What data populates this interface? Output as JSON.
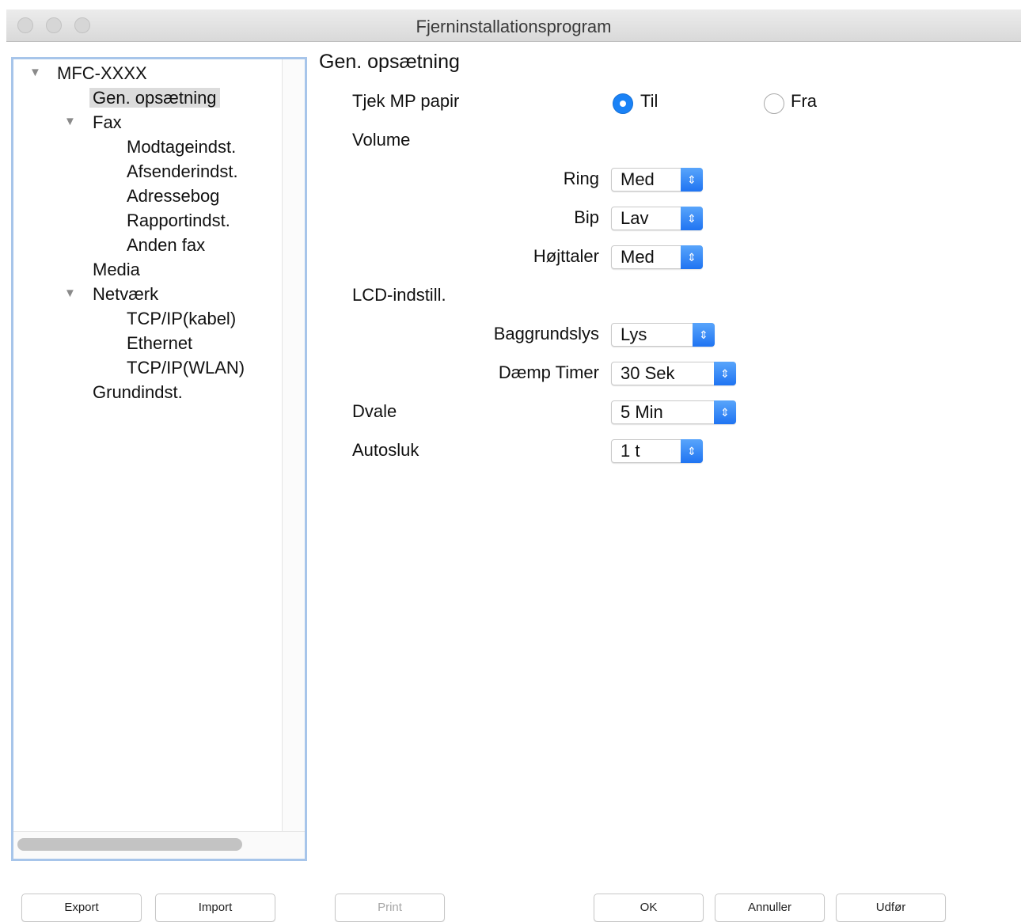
{
  "window": {
    "title": "Fjerninstallationsprogram"
  },
  "tree": {
    "root": "MFC-XXXX",
    "items": {
      "gen": "Gen. opsætning",
      "fax": "Fax",
      "modtag": "Modtageindst.",
      "afsender": "Afsenderindst.",
      "adressebog": "Adressebog",
      "rapport": "Rapportindst.",
      "anden": "Anden fax",
      "media": "Media",
      "netvaerk": "Netværk",
      "tcpip_kabel": "TCP/IP(kabel)",
      "ethernet": "Ethernet",
      "tcpip_wlan": "TCP/IP(WLAN)",
      "grundindst": "Grundindst."
    }
  },
  "main": {
    "heading": "Gen. opsætning",
    "tjek": {
      "label": "Tjek MP papir",
      "on_label": "Til",
      "off_label": "Fra",
      "selected": "Til"
    },
    "volume": {
      "label": "Volume",
      "ring": {
        "label": "Ring",
        "value": "Med"
      },
      "bip": {
        "label": "Bip",
        "value": "Lav"
      },
      "hoejttaler": {
        "label": "Højttaler",
        "value": "Med"
      }
    },
    "lcd": {
      "label": "LCD-indstill.",
      "baggrundslys": {
        "label": "Baggrundslys",
        "value": "Lys"
      },
      "daemp": {
        "label": "Dæmp Timer",
        "value": "30 Sek"
      }
    },
    "dvale": {
      "label": "Dvale",
      "value": "5 Min"
    },
    "autosluk": {
      "label": "Autosluk",
      "value": "1 t"
    }
  },
  "buttons": {
    "export": "Export",
    "import": "Import",
    "print": "Print",
    "ok": "OK",
    "annuller": "Annuller",
    "udfoer": "Udfør"
  },
  "colors": {
    "accent": "#1a82f6",
    "tree_border": "#a7c5ea"
  }
}
